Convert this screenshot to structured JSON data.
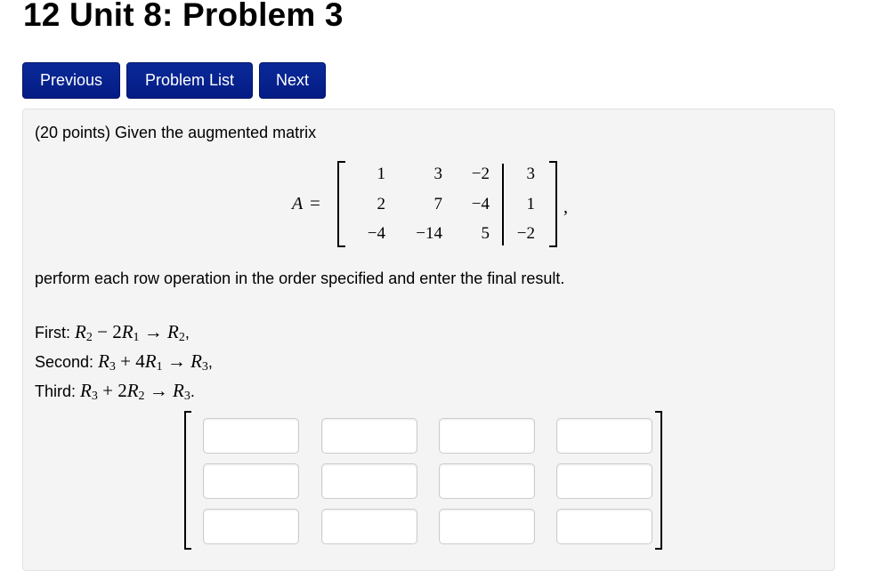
{
  "page": {
    "title": "12 Unit 8: Problem 3"
  },
  "nav": {
    "previous_label": "Previous",
    "problem_list_label": "Problem List",
    "next_label": "Next",
    "button_color": "#041b84"
  },
  "problem": {
    "intro": "(20 points) Given the augmented matrix",
    "matrix_label": "A",
    "equals": "=",
    "matrix": [
      [
        "1",
        "3",
        "−2",
        "3"
      ],
      [
        "2",
        "7",
        "−4",
        "1"
      ],
      [
        "−4",
        "−14",
        "5",
        "−2"
      ]
    ],
    "trailing_comma": ",",
    "instruction": "perform each row operation in the order specified and enter the final result.",
    "operations": [
      {
        "label": "First:",
        "lhs_a": "R",
        "lhs_a_sub": "2",
        "op": "−",
        "coef": "2",
        "lhs_b": "R",
        "lhs_b_sub": "1",
        "arrow": "→",
        "rhs": "R",
        "rhs_sub": "2",
        "end": ","
      },
      {
        "label": "Second:",
        "lhs_a": "R",
        "lhs_a_sub": "3",
        "op": "+",
        "coef": "4",
        "lhs_b": "R",
        "lhs_b_sub": "1",
        "arrow": "→",
        "rhs": "R",
        "rhs_sub": "3",
        "end": ","
      },
      {
        "label": "Third:",
        "lhs_a": "R",
        "lhs_a_sub": "3",
        "op": "+",
        "coef": "2",
        "lhs_b": "R",
        "lhs_b_sub": "2",
        "arrow": "→",
        "rhs": "R",
        "rhs_sub": "3",
        "end": "."
      }
    ]
  },
  "answer": {
    "rows": 3,
    "cols": 4,
    "values": [
      [
        "",
        "",
        "",
        ""
      ],
      [
        "",
        "",
        "",
        ""
      ],
      [
        "",
        "",
        "",
        ""
      ]
    ]
  }
}
